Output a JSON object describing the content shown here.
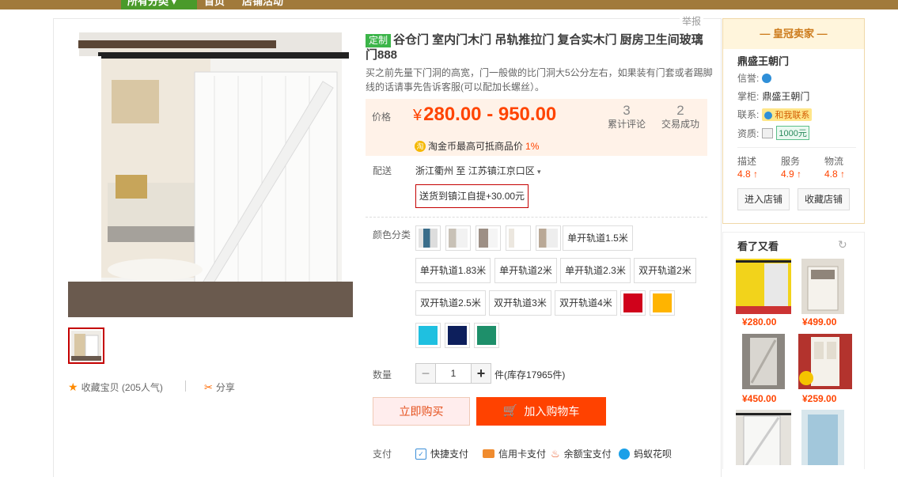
{
  "topnav": {
    "category": "所有分类",
    "home": "首页",
    "shop": "店铺活动"
  },
  "report": "举报",
  "product": {
    "badge": "定制",
    "title": "谷仓门 室内门木门 吊轨推拉门 复合实木门 厨房卫生间玻璃门888",
    "subtitle": "买之前先量下门洞的高宽，门一般做的比门洞大5公分左右，如果装有门套或者踢脚线的话请事先告诉客服(可以配加长螺丝）。",
    "price_label": "价格",
    "price_currency": "¥",
    "price": "280.00 - 950.00",
    "reviews_count": "3",
    "reviews_label": "累计评论",
    "deals_count": "2",
    "deals_label": "交易成功",
    "coin_text": "淘金币最高可抵商品价",
    "coin_pct": "1%",
    "ship_label": "配送",
    "ship_from": "浙江衢州 至",
    "ship_to": "江苏镇江京口区",
    "pickup": "送货到镇江自提+30.00元",
    "color_label": "颜色分类",
    "sku_text": [
      "单开轨道1.5米",
      "单开轨道1.83米",
      "单开轨道2米",
      "单开轨道2.3米",
      "双开轨道2米",
      "双开轨道2.5米",
      "双开轨道3米",
      "双开轨道4米"
    ],
    "color_swatches": [
      "#d0021b",
      "#ffb400",
      "#1fc0e0",
      "#0d1f5c",
      "#1e8f6a"
    ],
    "qty_label": "数量",
    "qty_value": "1",
    "qty_minus": "−",
    "qty_plus": "+",
    "stock": "件(库存17965件)",
    "buy_now": "立即购买",
    "add_cart": "加入购物车",
    "pay_label": "支付",
    "pay_methods": [
      "快捷支付",
      "信用卡支付",
      "余额宝支付",
      "蚂蚁花呗"
    ]
  },
  "gallery": {
    "favorite": "收藏宝贝 (205人气)",
    "share": "分享"
  },
  "seller": {
    "header": "— 皇冠卖家 —",
    "name": "鼎盛王朝门",
    "credit_label": "信誉:",
    "owner_label": "掌柜:",
    "owner": "鼎盛王朝门",
    "contact_label": "联系:",
    "contact": "和我联系",
    "qual_label": "资质:",
    "qual": "1000元",
    "ratings": [
      {
        "label": "描述",
        "value": "4.8"
      },
      {
        "label": "服务",
        "value": "4.9"
      },
      {
        "label": "物流",
        "value": "4.8"
      }
    ],
    "enter_shop": "进入店铺",
    "fav_shop": "收藏店铺"
  },
  "also": {
    "title": "看了又看",
    "prices": [
      "¥280.00",
      "¥499.00",
      "¥450.00",
      "¥259.00"
    ]
  },
  "colors": {
    "accent": "#ff4400",
    "brand": "#c40000",
    "nav": "#a17a3b"
  }
}
